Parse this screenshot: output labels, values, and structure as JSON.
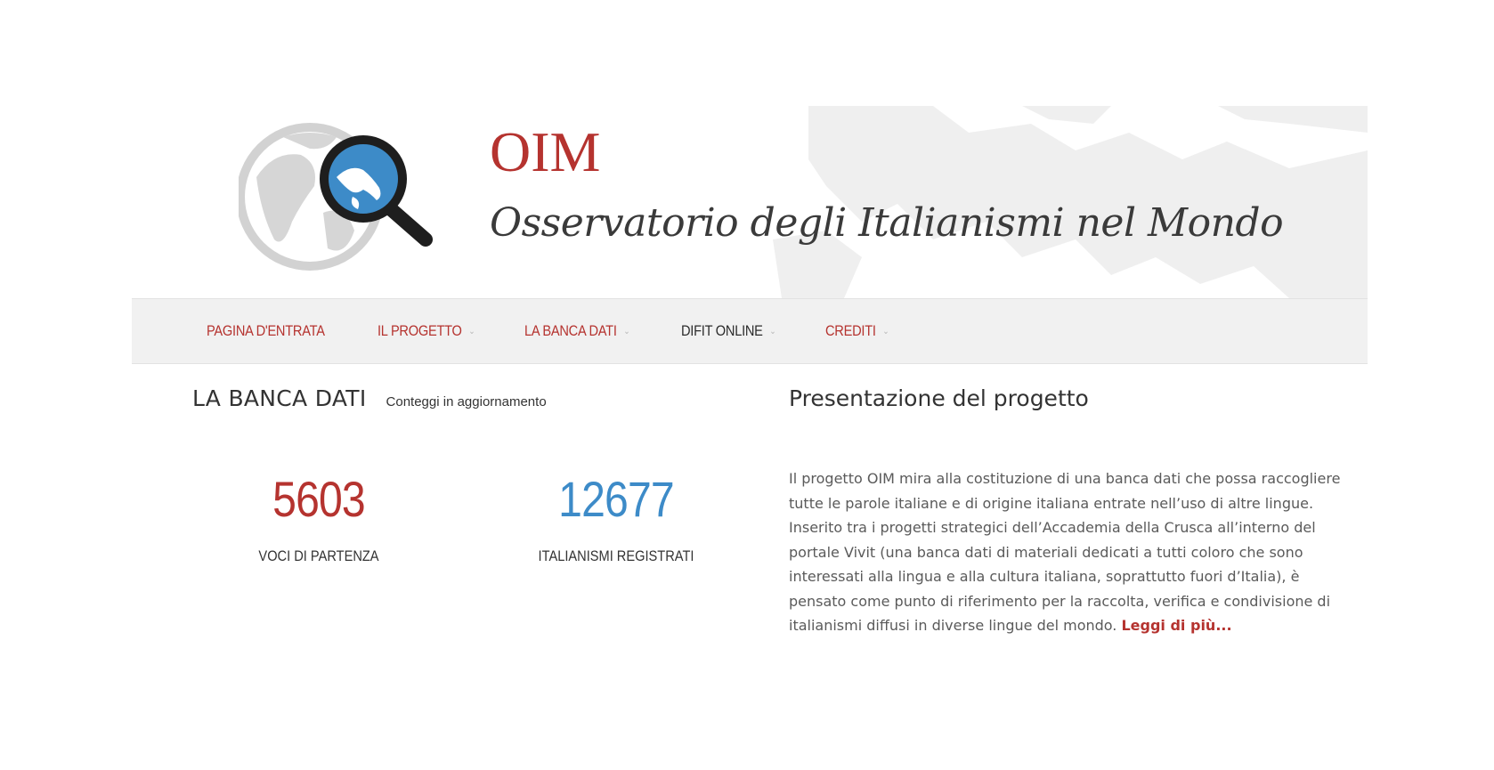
{
  "header": {
    "abbr": "OIM",
    "name": "Osservatorio degli Italianismi nel Mondo"
  },
  "nav": {
    "items": [
      {
        "label": "PAGINA D'ENTRATA",
        "dropdown": false
      },
      {
        "label": "IL PROGETTO",
        "dropdown": true
      },
      {
        "label": "LA BANCA DATI",
        "dropdown": true
      },
      {
        "label": "DIFIT ONLINE",
        "dropdown": true
      },
      {
        "label": "CREDITI",
        "dropdown": true
      }
    ]
  },
  "database": {
    "title": "LA BANCA DATI",
    "subtitle": "Conteggi in aggiornamento",
    "counters": [
      {
        "value": "5603",
        "label": "VOCI DI PARTENZA"
      },
      {
        "value": "12677",
        "label": "ITALIANISMI REGISTRATI"
      }
    ]
  },
  "presentation": {
    "title": "Presentazione del progetto",
    "text": "Il progetto OIM mira alla costituzione di una banca dati che possa raccogliere tutte le parole italiane e di origine italiana entrate nell’uso di altre lingue. Inserito tra i progetti strategici dell’Accademia della Crusca all’interno del portale Vivit (una banca dati di materiali dedicati a tutti coloro che sono interessati alla lingua e alla cultura italiana, soprattutto fuori d’Italia), è pensato come punto di riferimento per la raccolta, verifica e condivisione di italianismi diffusi in diverse lingue del mondo.",
    "read_more": "Leggi di più..."
  },
  "colors": {
    "accent": "#b5332f",
    "blue": "#3d8bc8",
    "nav_bg": "#f1f1f1"
  }
}
